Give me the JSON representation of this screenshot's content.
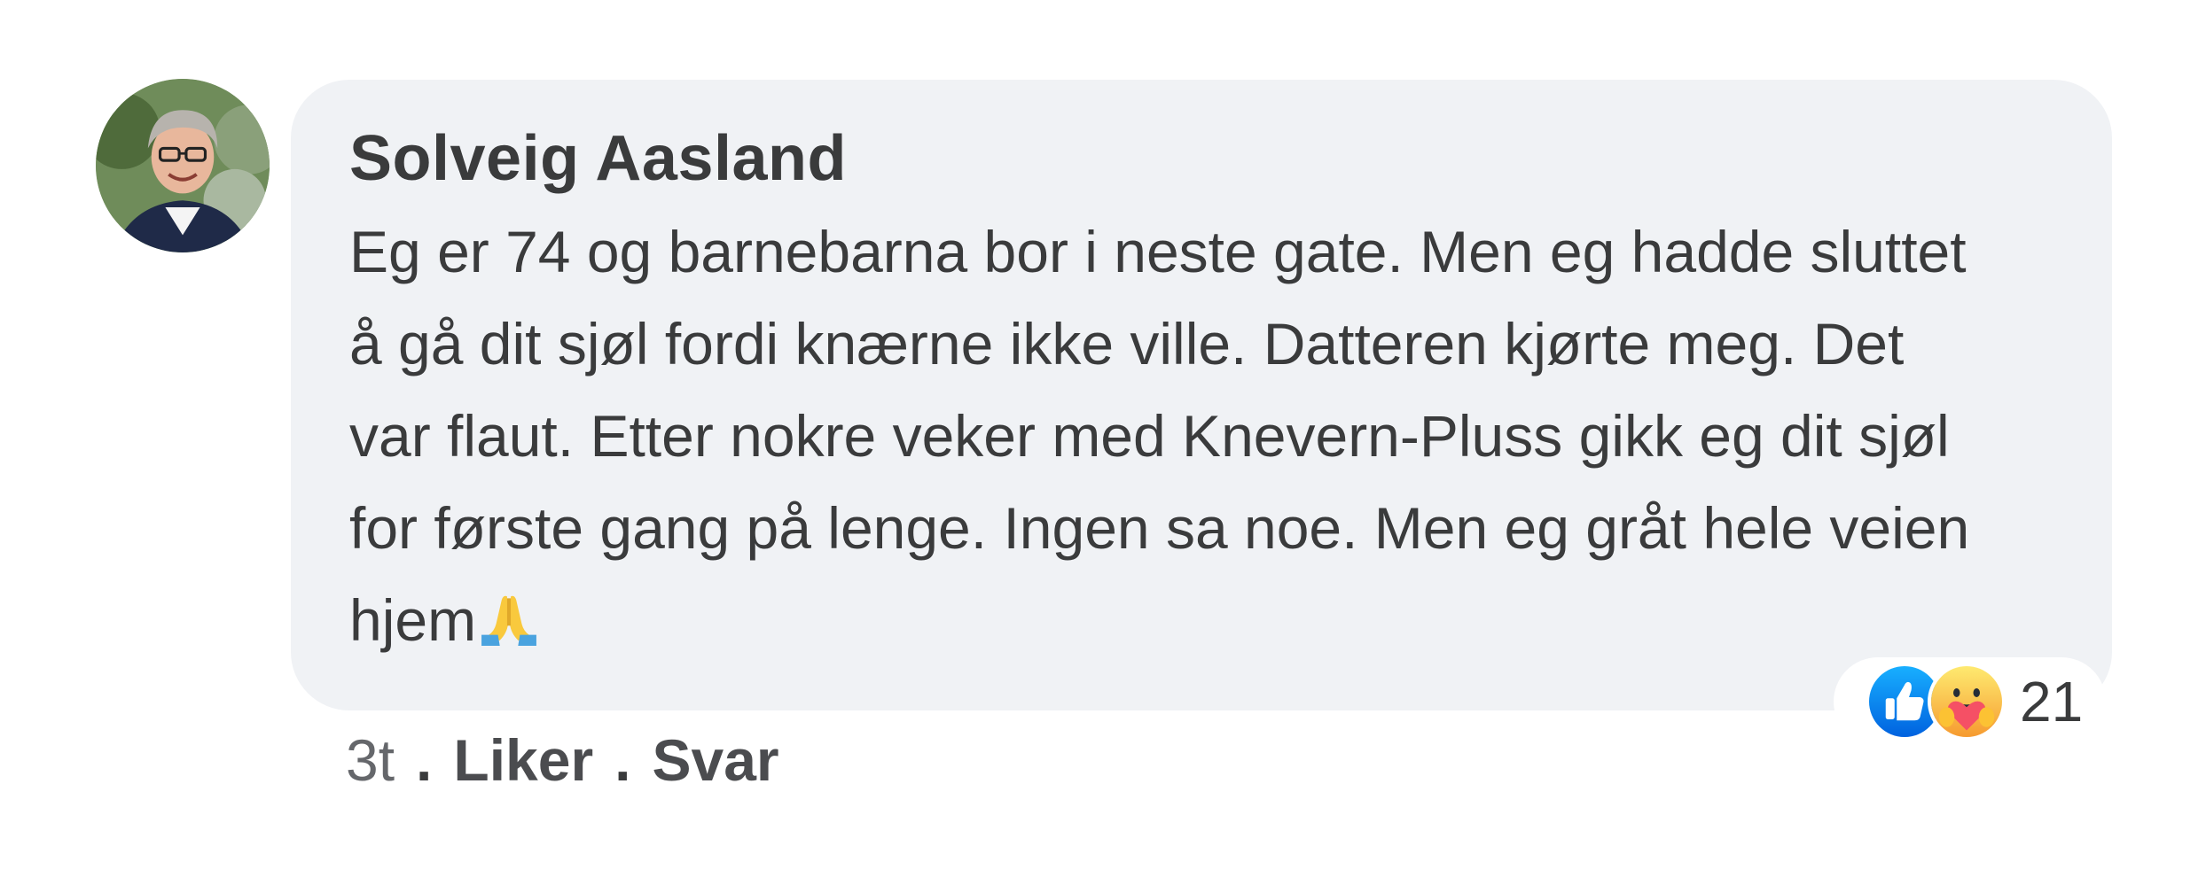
{
  "comment": {
    "author": "Solveig Aasland",
    "text": "Eg er 74 og barnebarna bor i neste gate. Men eg hadde sluttet\nå gå dit sjøl fordi knærne ikke ville. Datteren kjørte meg. Det\nvar flaut. Etter nokre veker med Knevern-Pluss gikk eg dit sjøl\nfor første gang på lenge. Ingen sa noe. Men eg gråt hele veien\nhjem",
    "emoji": "folded-hands-icon",
    "time": "3t",
    "separator": ".",
    "like_label": "Liker",
    "reply_label": "Svar",
    "reaction_count": "21",
    "reactions": [
      "like-icon",
      "care-icon"
    ]
  },
  "colors": {
    "bubble": "#f0f2f5",
    "text": "#3a3b3c",
    "muted": "#65676b",
    "like_blue": "#1877f2",
    "care_yellow": "#f7b125"
  }
}
